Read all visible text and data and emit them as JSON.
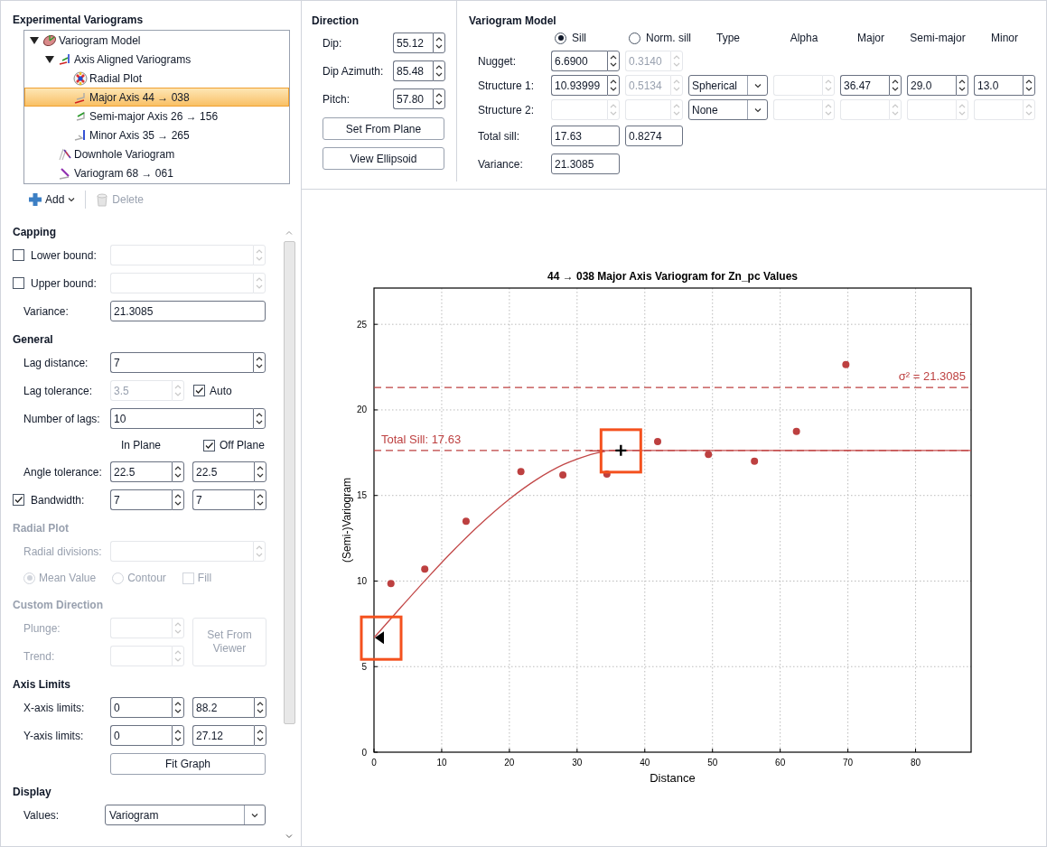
{
  "left_panel": {
    "title": "Experimental Variograms",
    "tree": [
      {
        "kind": "model",
        "label": "Variogram Model",
        "expanded": true,
        "selected": false,
        "children": [
          {
            "kind": "axes",
            "label": "Axis Aligned Variograms",
            "expanded": true,
            "selected": false,
            "children": [
              {
                "kind": "radial",
                "label": "Radial Plot",
                "selected": false
              },
              {
                "kind": "major",
                "label": "Major Axis 44 → 038",
                "selected": true
              },
              {
                "kind": "semi",
                "label": "Semi-major Axis 26 → 156",
                "selected": false
              },
              {
                "kind": "minor",
                "label": "Minor Axis 35 → 265",
                "selected": false
              }
            ]
          },
          {
            "kind": "downhole",
            "label": "Downhole Variogram",
            "selected": false
          },
          {
            "kind": "direction",
            "label": "Variogram 68 → 061",
            "selected": false
          }
        ]
      }
    ],
    "toolbar": [
      {
        "kind": "add",
        "label": "Add",
        "disabled": false
      },
      {
        "kind": "delete",
        "label": "Delete",
        "disabled": true
      }
    ],
    "sections": [
      {
        "title": "Capping",
        "disabled": false,
        "rows": [
          {
            "kind": "input",
            "label": "Lower bound:",
            "checked": false,
            "inputs": [
              {
                "spin": true,
                "disabled": true
              }
            ]
          },
          {
            "kind": "input",
            "label": "Upper bound:",
            "checked": false,
            "inputs": [
              {
                "spin": true,
                "disabled": true
              }
            ]
          },
          {
            "kind": "input",
            "label": "Variance:",
            "inputs": [
              {
                "value": "21.3085",
                "spin": false,
                "disabled": false
              }
            ]
          }
        ]
      },
      {
        "title": "General",
        "disabled": false,
        "rows": [
          {
            "kind": "input",
            "label": "Lag distance:",
            "inputs": [
              {
                "value": "7",
                "spin": true,
                "disabled": false
              }
            ]
          },
          {
            "kind": "input",
            "label": "Lag tolerance:",
            "inputs": [
              {
                "value": "3.5",
                "spin": true,
                "disabled": true
              }
            ],
            "check": {
              "label": "Auto",
              "checked": true
            }
          },
          {
            "kind": "input",
            "label": "Number of lags:",
            "inputs": [
              {
                "value": "10",
                "spin": true,
                "disabled": false
              }
            ]
          },
          {
            "kind": "headers",
            "labels": [
              "In Plane"
            ],
            "check": {
              "label": "Off Plane",
              "checked": true
            }
          },
          {
            "kind": "input",
            "label": "Angle tolerance:",
            "inputs": [
              {
                "value": "22.5",
                "spin": true,
                "disabled": false
              },
              {
                "value": "22.5",
                "spin": true,
                "disabled": false
              }
            ]
          },
          {
            "kind": "input",
            "label": "Bandwidth:",
            "checked": true,
            "inputs": [
              {
                "value": "7",
                "spin": true,
                "disabled": false
              },
              {
                "value": "7",
                "spin": true,
                "disabled": false
              }
            ]
          }
        ]
      },
      {
        "title": "Radial Plot",
        "disabled": true,
        "rows": [
          {
            "kind": "input",
            "label": "Radial divisions:",
            "inputs": [
              {
                "spin": true,
                "disabled": true
              }
            ]
          },
          {
            "kind": "options",
            "radios": [
              {
                "label": "Mean Value",
                "selected": true
              },
              {
                "label": "Contour",
                "selected": false
              }
            ],
            "check": {
              "label": "Fill",
              "checked": false
            }
          }
        ]
      },
      {
        "title": "Custom Direction",
        "disabled": true,
        "rows": [
          {
            "kind": "inputs_button",
            "fields": [
              {
                "label": "Plunge:",
                "inputs": [
                  {
                    "spin": true,
                    "disabled": true
                  }
                ]
              },
              {
                "label": "Trend:",
                "inputs": [
                  {
                    "spin": true,
                    "disabled": true
                  }
                ]
              }
            ],
            "button": {
              "label": "Set From Viewer",
              "disabled": true
            }
          }
        ]
      },
      {
        "title": "Axis Limits",
        "disabled": false,
        "rows": [
          {
            "kind": "input",
            "label": "X-axis limits:",
            "inputs": [
              {
                "value": "0",
                "spin": true,
                "disabled": false
              },
              {
                "value": "88.2",
                "spin": true,
                "disabled": false
              }
            ]
          },
          {
            "kind": "input",
            "label": "Y-axis limits:",
            "inputs": [
              {
                "value": "0",
                "spin": true,
                "disabled": false
              },
              {
                "value": "27.12",
                "spin": true,
                "disabled": false
              }
            ]
          },
          {
            "kind": "button",
            "label": "Fit Graph"
          }
        ]
      },
      {
        "title": "Display",
        "disabled": false,
        "rows": [
          {
            "kind": "select",
            "label": "Values:",
            "value": "Variogram"
          }
        ]
      }
    ]
  },
  "direction": {
    "title": "Direction",
    "fields": [
      {
        "label": "Dip:",
        "value": "55.12"
      },
      {
        "label": "Dip Azimuth:",
        "value": "85.48"
      },
      {
        "label": "Pitch:",
        "value": "57.80"
      }
    ],
    "buttons": [
      "Set From Plane",
      "View Ellipsoid"
    ]
  },
  "variogram_model": {
    "title": "Variogram Model",
    "sill_modes": [
      {
        "label": "Sill",
        "selected": true
      },
      {
        "label": "Norm. sill",
        "selected": false
      }
    ],
    "columns": [
      "Type",
      "Alpha",
      "Major",
      "Semi-major",
      "Minor"
    ],
    "rows": [
      {
        "kind": "structure",
        "label": "Nugget:",
        "sill": {
          "value": "6.6900",
          "disabled": false
        },
        "norm_sill": {
          "value": "0.3140",
          "disabled": true
        }
      },
      {
        "kind": "structure",
        "label": "Structure 1:",
        "sill": {
          "value": "10.93999",
          "disabled": false
        },
        "norm_sill": {
          "value": "0.5134",
          "disabled": true
        },
        "type": "Spherical",
        "alpha": {
          "disabled": true
        },
        "major": {
          "value": "36.47",
          "disabled": false
        },
        "semi_major": {
          "value": "29.0",
          "disabled": false
        },
        "minor": {
          "value": "13.0",
          "disabled": false
        }
      },
      {
        "kind": "structure",
        "label": "Structure 2:",
        "sill": {
          "disabled": true
        },
        "norm_sill": {
          "disabled": true
        },
        "type": "None",
        "alpha": {
          "disabled": true
        },
        "major": {
          "disabled": true
        },
        "semi_major": {
          "disabled": true
        },
        "minor": {
          "disabled": true
        }
      },
      {
        "kind": "total",
        "label": "Total sill:",
        "values": [
          "17.63",
          "0.8274"
        ]
      },
      {
        "kind": "total",
        "label": "Variance:",
        "values": [
          "21.3085"
        ]
      }
    ]
  },
  "chart": {
    "chart_data": {
      "type": "scatter",
      "title": "44 → 038 Major Axis Variogram for Zn_pc Values",
      "xlabel": "Distance",
      "ylabel": "(Semi-)Variogram",
      "x": [
        0,
        2.5,
        4,
        7.5,
        8,
        12,
        13.6,
        16,
        20,
        21.7,
        24,
        27.9,
        28,
        32,
        34,
        34.4,
        36.47,
        41.9,
        49.4,
        56.2,
        62.4,
        69.7,
        88.2
      ],
      "series": [
        {
          "type": "scatter",
          "color": "#bd4040",
          "values": [
            null,
            9.85,
            null,
            10.7,
            null,
            null,
            13.5,
            null,
            null,
            16.4,
            null,
            16.2,
            null,
            null,
            null,
            16.25,
            null,
            18.15,
            17.4,
            17.0,
            18.75,
            22.65,
            null
          ]
        },
        {
          "type": "line",
          "color": "#c24848",
          "values": [
            6.69,
            null,
            8.48,
            null,
            10.23,
            11.9,
            null,
            13.43,
            14.79,
            null,
            15.93,
            null,
            16.81,
            17.39,
            17.56,
            null,
            17.63,
            null,
            null,
            null,
            null,
            null,
            17.63
          ]
        }
      ],
      "grid": true,
      "xlim": [
        0,
        88.2
      ],
      "ylim": [
        0,
        27.12
      ],
      "xticks": [
        0,
        10,
        20,
        30,
        40,
        50,
        60,
        70,
        80
      ],
      "yticks": [
        0,
        5,
        10,
        15,
        20,
        25
      ],
      "ref_lines": [
        {
          "axis": "y",
          "value": 17.63,
          "label": "Total Sill: 17.63"
        },
        {
          "axis": "y",
          "value": 21.3085,
          "label": "σ² = 21.3085"
        }
      ]
    }
  }
}
